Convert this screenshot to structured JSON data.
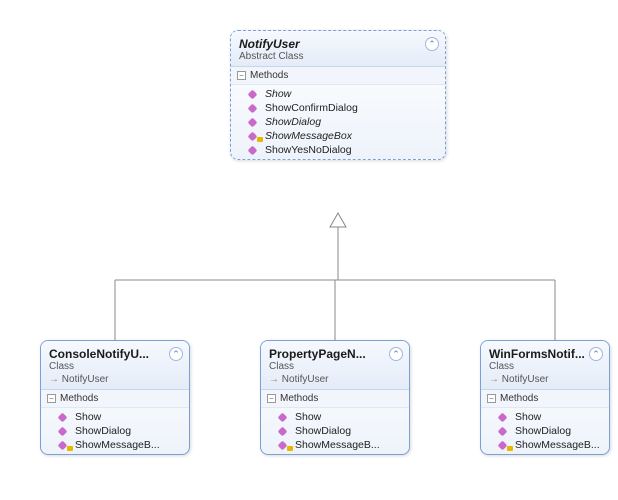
{
  "parent": {
    "name": "NotifyUser",
    "stereotype": "Abstract Class",
    "sectionLabel": "Methods",
    "methods": [
      {
        "name": "Show",
        "italic": true,
        "access": "public"
      },
      {
        "name": "ShowConfirmDialog",
        "italic": false,
        "access": "public"
      },
      {
        "name": "ShowDialog",
        "italic": true,
        "access": "public"
      },
      {
        "name": "ShowMessageBox",
        "italic": true,
        "access": "protected"
      },
      {
        "name": "ShowYesNoDialog",
        "italic": false,
        "access": "public"
      }
    ]
  },
  "children": [
    {
      "name": "ConsoleNotifyU...",
      "stereotype": "Class",
      "inherits": "NotifyUser",
      "sectionLabel": "Methods",
      "methods": [
        {
          "name": "Show",
          "access": "public"
        },
        {
          "name": "ShowDialog",
          "access": "public"
        },
        {
          "name": "ShowMessageB...",
          "access": "protected"
        }
      ]
    },
    {
      "name": "PropertyPageN...",
      "stereotype": "Class",
      "inherits": "NotifyUser",
      "sectionLabel": "Methods",
      "methods": [
        {
          "name": "Show",
          "access": "public"
        },
        {
          "name": "ShowDialog",
          "access": "public"
        },
        {
          "name": "ShowMessageB...",
          "access": "protected"
        }
      ]
    },
    {
      "name": "WinFormsNotif...",
      "stereotype": "Class",
      "inherits": "NotifyUser",
      "sectionLabel": "Methods",
      "methods": [
        {
          "name": "Show",
          "access": "public"
        },
        {
          "name": "ShowDialog",
          "access": "public"
        },
        {
          "name": "ShowMessageB...",
          "access": "protected"
        }
      ]
    }
  ],
  "labels": {
    "collapse": "⌃",
    "toggle": "−"
  }
}
